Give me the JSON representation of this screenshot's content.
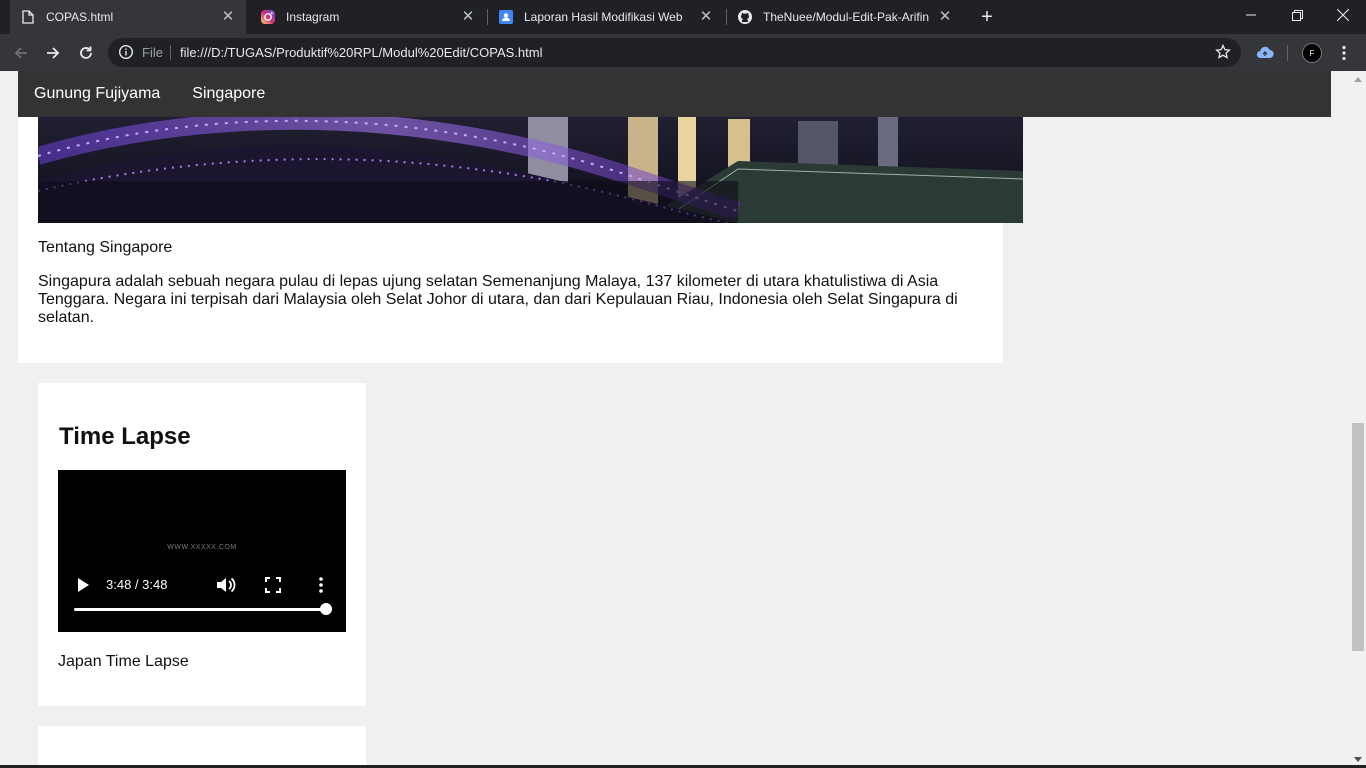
{
  "browser": {
    "tabs": [
      {
        "title": "COPAS.html",
        "active": true,
        "icon": "document-icon"
      },
      {
        "title": "Instagram",
        "active": false,
        "icon": "instagram-icon"
      },
      {
        "title": "Laporan Hasil Modifikasi Web",
        "active": false,
        "icon": "google-sites-icon"
      },
      {
        "title": "TheNuee/Modul-Edit-Pak-Arifin",
        "active": false,
        "icon": "github-icon"
      }
    ],
    "close_symbol": "✕",
    "new_tab_symbol": "+",
    "address": {
      "scheme_label": "File",
      "url": "file:///D:/TUGAS/Produktif%20RPL/Modul%20Edit/COPAS.html"
    },
    "profile_initial": "F"
  },
  "page": {
    "nav": [
      "Gunung Fujiyama",
      "Singapore"
    ],
    "about_title": "Tentang Singapore",
    "about_text": "Singapura adalah sebuah negara pulau di lepas ujung selatan Semenanjung Malaya, 137 kilometer di utara khatulistiwa di Asia Tenggara. Negara ini terpisah dari Malaysia oleh Selat Johor di utara, dan dari Kepulauan Riau, Indonesia oleh Selat Singapura di selatan.",
    "timelapse": {
      "heading": "Time Lapse",
      "video_time": "3:48 / 3:48",
      "video_progress": 1.0,
      "watermark": "WWW.XXXXX.COM",
      "caption": "Japan Time Lapse"
    }
  },
  "colors": {
    "tabstrip": "#202124",
    "toolbar": "#35363a",
    "navbar": "#333333",
    "page_bg": "#f0f0f0"
  }
}
